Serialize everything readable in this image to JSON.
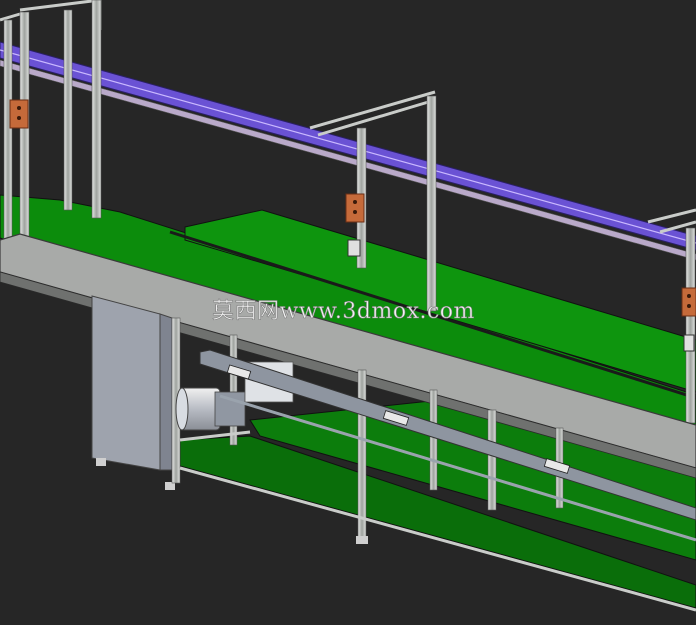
{
  "scene": {
    "subject": "conveyor-line-3d-model",
    "background_color": "#262626",
    "belt_color": "#0c8a0c",
    "rail_color": "#5a3fc4",
    "frame_color": "#c9ccc9",
    "plate_color": "#9aa0aa"
  },
  "watermark": {
    "text": "莫西网www.3dmox.com"
  }
}
